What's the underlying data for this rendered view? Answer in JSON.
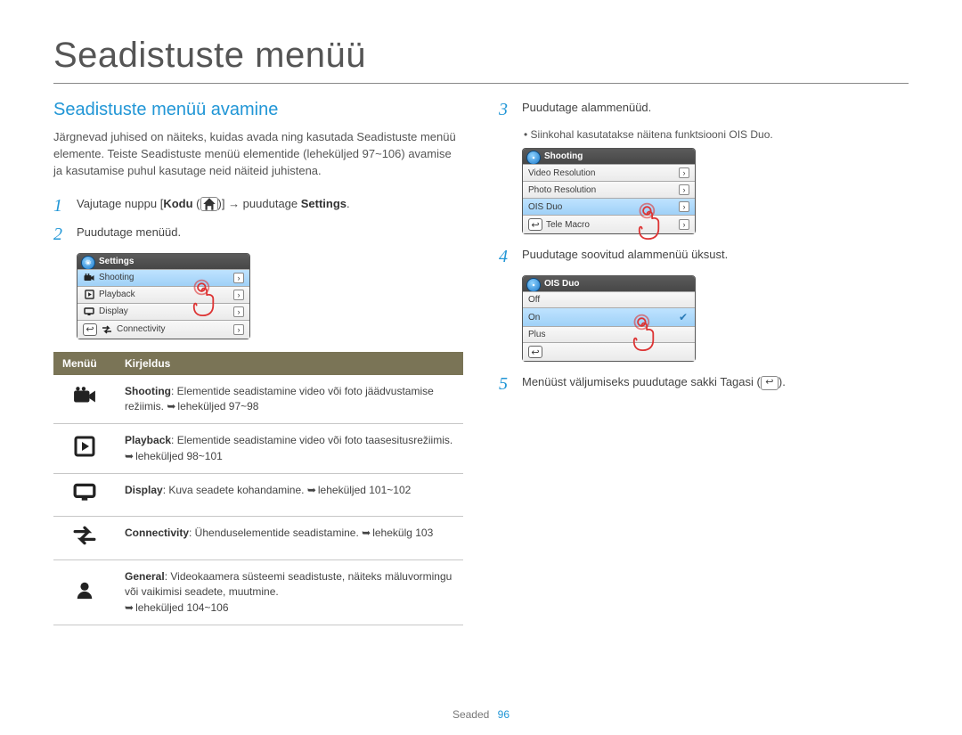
{
  "page": {
    "title": "Seadistuste menüü",
    "section_title": "Seadistuste menüü avamine",
    "intro": "Järgnevad juhised on näiteks, kuidas avada ning kasutada Seadistuste menüü elemente. Teiste Seadistuste menüü elementide (leheküljed 97~106) avamise ja kasutamise puhul kasutage neid näiteid juhistena.",
    "footer_label": "Seaded",
    "footer_page": "96"
  },
  "steps": {
    "s1_pre": "Vajutage nuppu [",
    "s1_kodu": "Kodu",
    "s1_mid": " (",
    "s1_post": ")] → puudutage ",
    "s1_settings": "Settings",
    "s1_end": ".",
    "s2": "Puudutage menüüd.",
    "s3": "Puudutage alammenüüd.",
    "s3_sub": "Siinkohal kasutatakse näitena funktsiooni OIS Duo.",
    "s4": "Puudutage soovitud alammenüü üksust.",
    "s5_pre": "Menüüst väljumiseks puudutage sakki Tagasi (",
    "s5_post": ")."
  },
  "ui_settings": {
    "title": "Settings",
    "rows": [
      {
        "icon": "camera",
        "label": "Shooting",
        "selected": true
      },
      {
        "icon": "play",
        "label": "Playback"
      },
      {
        "icon": "display",
        "label": "Display"
      },
      {
        "icon": "conn",
        "label": "Connectivity"
      }
    ]
  },
  "ui_shooting": {
    "title": "Shooting",
    "rows": [
      {
        "label": "Video Resolution"
      },
      {
        "label": "Photo Resolution"
      },
      {
        "label": "OIS Duo",
        "selected": true
      },
      {
        "label": "Tele Macro"
      }
    ]
  },
  "ui_oisduo": {
    "title": "OIS Duo",
    "rows": [
      {
        "label": "Off"
      },
      {
        "label": "On",
        "selected": true,
        "check": true
      },
      {
        "label": "Plus"
      }
    ]
  },
  "table": {
    "head_menu": "Menüü",
    "head_desc": "Kirjeldus",
    "rows": [
      {
        "icon": "camera",
        "label": "Shooting",
        "desc": ": Elementide seadistamine video või foto jäädvustamise režiimis. ",
        "page": "leheküljed 97~98"
      },
      {
        "icon": "play",
        "label": "Playback",
        "desc": ": Elementide seadistamine video või foto taasesitusrežiimis. ",
        "page": "leheküljed 98~101"
      },
      {
        "icon": "display",
        "label": "Display",
        "desc": ": Kuva seadete kohandamine. ",
        "page": "leheküljed 101~102"
      },
      {
        "icon": "conn",
        "label": "Connectivity",
        "desc": ": Ühenduselementide seadistamine. ",
        "page": "lehekülg 103"
      },
      {
        "icon": "user",
        "label": "General",
        "desc": ": Videokaamera süsteemi seadistuste, näiteks mäluvormingu või vaikimisi seadete, muutmine. ",
        "page": "leheküljed 104~106"
      }
    ]
  }
}
